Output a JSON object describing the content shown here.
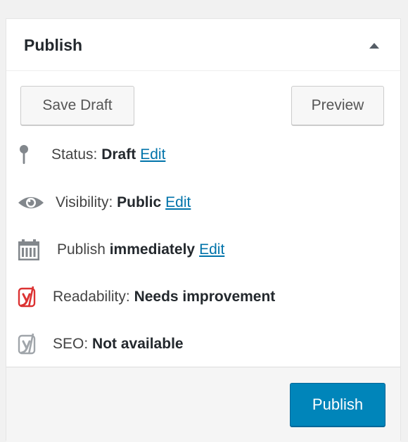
{
  "colors": {
    "link": "#0073aa",
    "primary_button": "#0085ba",
    "yoast_red": "#dc3232",
    "icon_gray": "#82878c"
  },
  "panel": {
    "title": "Publish",
    "toggle_icon": "arrow-up-icon"
  },
  "actions": {
    "save_draft": "Save Draft",
    "preview": "Preview"
  },
  "status": {
    "icon": "pin-icon",
    "label": "Status: ",
    "value": "Draft",
    "edit": "Edit"
  },
  "visibility": {
    "icon": "eye-icon",
    "label": "Visibility: ",
    "value": "Public",
    "edit": "Edit"
  },
  "publish_time": {
    "icon": "calendar-icon",
    "label": "Publish ",
    "value": "immediately",
    "edit": "Edit"
  },
  "readability": {
    "icon": "yoast-icon",
    "label": "Readability: ",
    "value": "Needs improvement",
    "color": "#dc3232"
  },
  "seo": {
    "icon": "yoast-icon",
    "label": "SEO: ",
    "value": "Not available",
    "color": "#a0a5aa"
  },
  "footer": {
    "publish": "Publish"
  }
}
